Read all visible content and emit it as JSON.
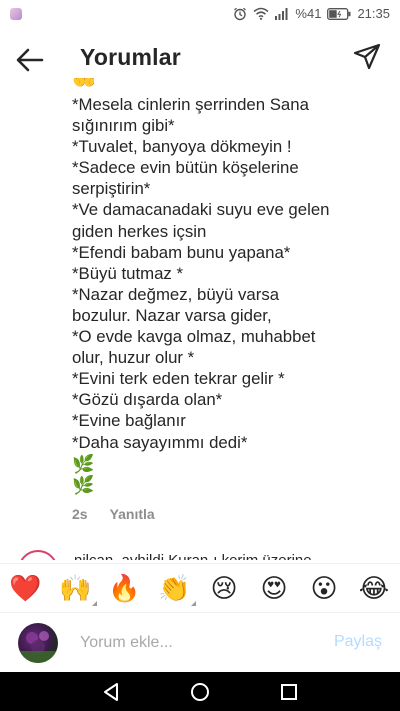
{
  "status_bar": {
    "battery_percent": "%41",
    "time": "21:35",
    "icons": [
      "alarm-icon",
      "wifi-icon",
      "signal-icon",
      "battery-icon"
    ]
  },
  "header": {
    "title": "Yorumlar",
    "back_icon": "arrow-left-icon",
    "send_icon": "direct-send-icon"
  },
  "comment": {
    "top_emoji": "🤲",
    "lines": [
      "*Mesela cinlerin şerrinden Sana",
      "sığınırım gibi*",
      "*Tuvalet, banyoya dökmeyin !",
      "*Sadece evin bütün köşelerine",
      "serpiştirin*",
      "*Ve damacanadaki suyu eve gelen",
      "giden herkes içsin",
      "*Efendi babam bunu yapana*",
      "*Büyü tutmaz *",
      "*Nazar değmez, büyü varsa",
      "bozulur. Nazar varsa gider,",
      "*O evde kavga olmaz, muhabbet",
      "olur, huzur olur *",
      "*Evini terk eden tekrar gelir *",
      "*Gözü dışarda olan*",
      "*Evine bağlanır",
      "*Daha sayayımmı dedi*"
    ],
    "leaves": [
      "🌿",
      "🌿"
    ],
    "time_ago": "2s",
    "reply_label": "Yanıtla"
  },
  "next_comment": {
    "text_partial": "nilcan_ayhildi Kuran-ı kerim üzerine"
  },
  "reactions": [
    {
      "emoji": "❤️",
      "name": "heart-emoji",
      "has_variants": false
    },
    {
      "emoji": "🙌",
      "name": "raising-hands-emoji",
      "has_variants": true
    },
    {
      "emoji": "🔥",
      "name": "fire-emoji",
      "has_variants": false
    },
    {
      "emoji": "👏",
      "name": "clapping-hands-emoji",
      "has_variants": true
    },
    {
      "emoji": "😢",
      "name": "crying-face-emoji",
      "has_variants": false
    },
    {
      "emoji": "😍",
      "name": "heart-eyes-emoji",
      "has_variants": false
    },
    {
      "emoji": "😮",
      "name": "surprised-face-emoji",
      "has_variants": false
    },
    {
      "emoji": "😂",
      "name": "tears-of-joy-emoji",
      "has_variants": false
    }
  ],
  "input": {
    "placeholder": "Yorum ekle...",
    "value": "",
    "post_label": "Paylaş",
    "post_color": "#b3dbff"
  },
  "nav_bar": {
    "buttons": [
      "back-triangle-icon",
      "home-circle-icon",
      "recents-square-icon"
    ]
  }
}
